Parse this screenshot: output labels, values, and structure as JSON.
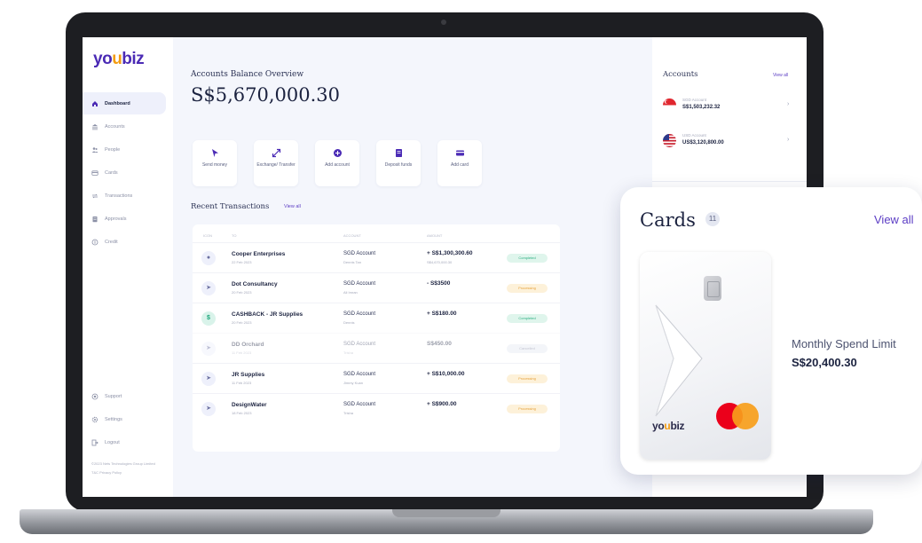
{
  "app": {
    "logo": "youbiz"
  },
  "sidebar": {
    "items": [
      {
        "label": "Dashboard",
        "icon": "home-icon",
        "active": true
      },
      {
        "label": "Accounts",
        "icon": "bank-icon"
      },
      {
        "label": "People",
        "icon": "people-icon"
      },
      {
        "label": "Cards",
        "icon": "card-icon"
      },
      {
        "label": "Transactions",
        "icon": "transfer-icon"
      },
      {
        "label": "Approvals",
        "icon": "clipboard-icon"
      },
      {
        "label": "Credit",
        "icon": "credit-icon"
      }
    ],
    "bottom": [
      {
        "label": "Support",
        "icon": "support-icon"
      },
      {
        "label": "Settings",
        "icon": "gear-icon"
      },
      {
        "label": "Logout",
        "icon": "logout-icon"
      }
    ],
    "legal": "©2023 Nets Technologies Group Limited",
    "privacy": "T&C  Privacy Policy"
  },
  "overview": {
    "title": "Accounts Balance Overview",
    "balance": "S$5,670,000.30"
  },
  "actions": [
    {
      "label": "Send money",
      "icon": "send-icon"
    },
    {
      "label": "Exchange/ Transfer",
      "icon": "exchange-icon"
    },
    {
      "label": "Add account",
      "icon": "add-account-icon"
    },
    {
      "label": "Deposit funds",
      "icon": "deposit-icon"
    },
    {
      "label": "Add card",
      "icon": "add-card-icon"
    }
  ],
  "recent": {
    "title": "Recent Transactions",
    "view_all": "View all",
    "columns": [
      "ICON",
      "TO",
      "ACCOUNT",
      "AMOUNT"
    ],
    "rows": [
      {
        "name": "Cooper Enterprises",
        "date": "22 Feb 2023",
        "account": "SGD Account",
        "account_sub": "Dennis Tan",
        "amount": "+ S$1,300,300.60",
        "amount_sub": "S$4,670,000.30",
        "status": "Completed",
        "status_type": "completed",
        "icon": "user-icon"
      },
      {
        "name": "Dot Consultancy",
        "date": "20 Feb 2023",
        "account": "SGD Account",
        "account_sub": "Ali Imran",
        "amount": "- S$3500",
        "amount_sub": "",
        "status": "Processing",
        "status_type": "processing",
        "icon": "send-icon"
      },
      {
        "name": "CASHBACK - JR Supplies",
        "date": "20 Feb 2023",
        "account": "SGD Account",
        "account_sub": "Dennis",
        "amount": "+ S$180.00",
        "amount_sub": "",
        "status": "Completed",
        "status_type": "completed",
        "icon": "cashback-icon"
      },
      {
        "name": "DD Orchard",
        "date": "11 Feb 2023",
        "account": "SGD Account",
        "account_sub": "Trisha",
        "amount": "S$450.00",
        "amount_sub": "",
        "status": "Cancelled",
        "status_type": "cancelled",
        "icon": "send-icon",
        "faded": true
      },
      {
        "name": "JR Supplies",
        "date": "11 Feb 2023",
        "account": "SGD Account",
        "account_sub": "Jimmy Kuan",
        "amount": "+ S$10,000.00",
        "amount_sub": "",
        "status": "Processing",
        "status_type": "processing",
        "icon": "send-icon"
      },
      {
        "name": "DesignWater",
        "date": "18 Feb 2023",
        "account": "SGD Account",
        "account_sub": "Trisha",
        "amount": "+ S$900.00",
        "amount_sub": "",
        "status": "Processing",
        "status_type": "processing",
        "icon": "send-icon"
      }
    ]
  },
  "accounts": {
    "title": "Accounts",
    "view_all": "View all",
    "items": [
      {
        "name": "SGD Account",
        "balance": "S$1,503,232.32",
        "flag": "sg-flag-icon"
      },
      {
        "name": "USD Account",
        "balance": "US$3,120,800.00",
        "flag": "us-flag-icon"
      }
    ]
  },
  "cards_popup": {
    "title": "Cards",
    "count": "11",
    "view_all": "View all",
    "card_brand": "youbiz",
    "limit_label": "Monthly Spend Limit",
    "limit_value": "S$20,400.30"
  }
}
